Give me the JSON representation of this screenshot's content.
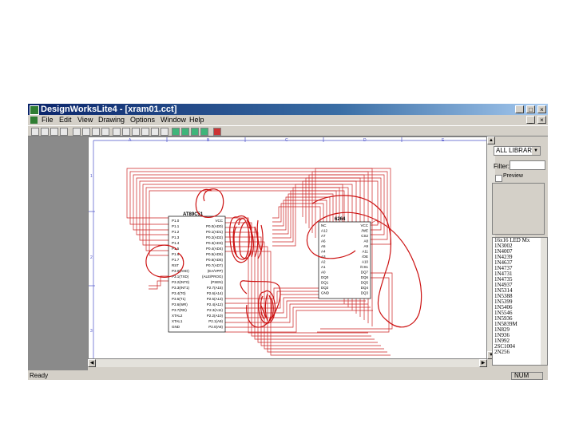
{
  "window": {
    "title": "DesignWorksLite4 - [xram01.cct]",
    "min": "_",
    "max": "□",
    "close": "×"
  },
  "menu": [
    "File",
    "Edit",
    "View",
    "Drawing",
    "Options",
    "Window",
    "Help"
  ],
  "ruler": {
    "top": [
      "A",
      "B",
      "C",
      "D",
      "E"
    ],
    "left": [
      "1",
      "2",
      "3"
    ]
  },
  "chip1": {
    "name": "AT89C51",
    "left_pins": [
      "P1.0",
      "P1.1",
      "P1.2",
      "P1.3",
      "P1.4",
      "P1.5",
      "P1.6",
      "P1.7",
      "RST",
      "P3.0(RXD)",
      "P3.1(TXD)",
      "P3.2(INT0)",
      "P3.3(INT1)",
      "P3.4(T0)",
      "P3.5(T1)",
      "P3.6(WR)",
      "P3.7(RD)",
      "XTAL2",
      "XTAL1",
      "GND"
    ],
    "right_pins": [
      "VCC",
      "P0.0(AD0)",
      "P0.1(AD1)",
      "P0.2(AD2)",
      "P0.3(AD3)",
      "P0.4(AD4)",
      "P0.5(AD5)",
      "P0.6(AD6)",
      "P0.7(AD7)",
      "(EA/VPP)",
      "(ALE/PROG)",
      "(PSEN)",
      "P2.7(A15)",
      "P2.6(A14)",
      "P2.5(A13)",
      "P2.4(A12)",
      "P2.3(A11)",
      "P2.2(A10)",
      "P2.1(A9)",
      "P2.0(A8)"
    ]
  },
  "chip2": {
    "name": "6264",
    "left_pins": [
      "NC",
      "A12",
      "A7",
      "A6",
      "A5",
      "A4",
      "A3",
      "A2",
      "A1",
      "A0",
      "DQ0",
      "DQ1",
      "DQ2",
      "GND"
    ],
    "right_pins": [
      "VCC",
      "/WE",
      "CS2",
      "A8",
      "A9",
      "A11",
      "/OE",
      "A10",
      "/CS1",
      "DQ7",
      "DQ6",
      "DQ5",
      "DQ4",
      "DQ3"
    ]
  },
  "panel": {
    "library": "ALL LIBRAR",
    "filter_label": "Filter:",
    "filter_value": "",
    "preview_label": "Preview",
    "parts": [
      "16x16 LED Mx",
      "1N3002",
      "1N4007",
      "1N4239",
      "1N4637",
      "1N4737",
      "1N4731",
      "1N4735",
      "1N4937",
      "1N5314",
      "1N5388",
      "1N5399",
      "1N5406",
      "1N5546",
      "1N5936",
      "1N5839M",
      "1N829",
      "1N936",
      "1N992",
      "2SC1004",
      "2N256"
    ]
  },
  "status": {
    "text": "Ready",
    "num": "NUM"
  },
  "colors": {
    "wire": "#cc2222",
    "ink": "#cc1111",
    "grid": "#4a50c8",
    "title_bar": "#0a246a"
  }
}
